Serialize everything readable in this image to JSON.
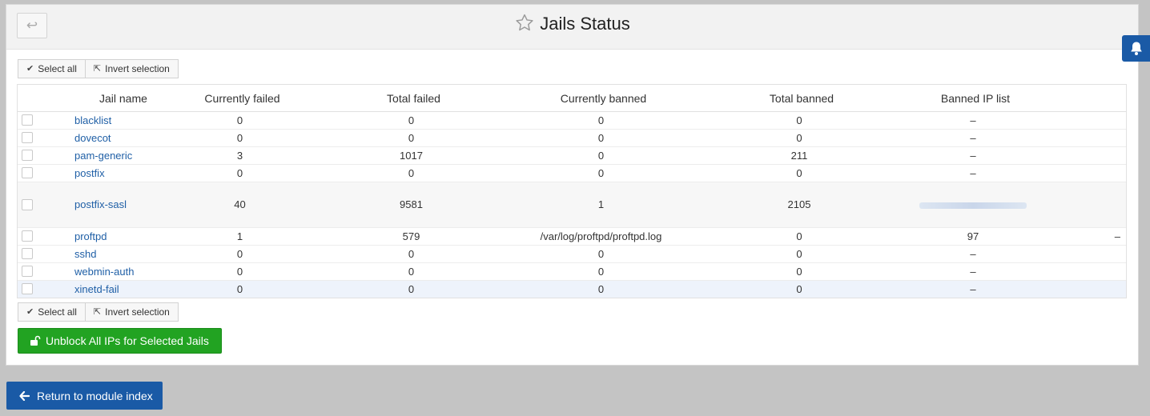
{
  "page": {
    "title": "Jails Status",
    "back_glyph": "↩"
  },
  "selection": {
    "select_all": "Select all",
    "invert": "Invert selection"
  },
  "table": {
    "headers": {
      "name": "Jail name",
      "currently_failed": "Currently failed",
      "total_failed": "Total failed",
      "currently_banned": "Currently banned",
      "total_banned": "Total banned",
      "banned_ip": "Banned IP list"
    },
    "rows": [
      {
        "name": "blacklist",
        "cf": "0",
        "tf": "0",
        "cb": "0",
        "tb": "0",
        "ip": "–"
      },
      {
        "name": "dovecot",
        "cf": "0",
        "tf": "0",
        "cb": "0",
        "tb": "0",
        "ip": "–"
      },
      {
        "name": "pam-generic",
        "cf": "3",
        "tf": "1017",
        "cb": "0",
        "tb": "211",
        "ip": "–"
      },
      {
        "name": "postfix",
        "cf": "0",
        "tf": "0",
        "cb": "0",
        "tb": "0",
        "ip": "–"
      },
      {
        "name": "postfix-sasl",
        "cf": "40",
        "tf": "9581",
        "cb": "1",
        "tb": "2105",
        "ip": ""
      },
      {
        "name": "proftpd",
        "cf": "1",
        "tf": "579",
        "cb": "/var/log/proftpd/proftpd.log",
        "tb": "0",
        "ip": "97",
        "extra": "–"
      },
      {
        "name": "sshd",
        "cf": "0",
        "tf": "0",
        "cb": "0",
        "tb": "0",
        "ip": "–"
      },
      {
        "name": "webmin-auth",
        "cf": "0",
        "tf": "0",
        "cb": "0",
        "tb": "0",
        "ip": "–"
      },
      {
        "name": "xinetd-fail",
        "cf": "0",
        "tf": "0",
        "cb": "0",
        "tb": "0",
        "ip": "–"
      }
    ]
  },
  "actions": {
    "unblock": "Unblock All IPs for Selected Jails",
    "return": "Return to module index"
  },
  "colors": {
    "accent_blue": "#1a5aa6",
    "success_green": "#22a322",
    "link": "#1f5fa6"
  }
}
